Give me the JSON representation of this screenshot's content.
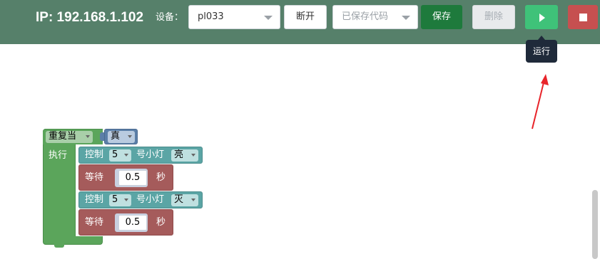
{
  "header": {
    "ip_text": "IP: 192.168.1.102",
    "device_label": "设备：",
    "device_select_value": "pl033",
    "disconnect_label": "断开",
    "saved_code_placeholder": "已保存代码",
    "save_label": "保存",
    "delete_label": "删除",
    "run_tooltip": "运行",
    "colors": {
      "bar": "#56806a",
      "save": "#1e7a3c",
      "run": "#3fc279",
      "stop": "#c65050"
    }
  },
  "workspace": {
    "loop": {
      "keyword": "重复当",
      "condition": "真",
      "do_label": "执行"
    },
    "statements": [
      {
        "type": "control",
        "keyword": "控制",
        "pin": "5",
        "unit": "号小灯",
        "state": "亮"
      },
      {
        "type": "wait",
        "keyword": "等待",
        "value": "0.5",
        "unit": "秒"
      },
      {
        "type": "control",
        "keyword": "控制",
        "pin": "5",
        "unit": "号小灯",
        "state": "灭"
      },
      {
        "type": "wait",
        "keyword": "等待",
        "value": "0.5",
        "unit": "秒"
      }
    ]
  }
}
